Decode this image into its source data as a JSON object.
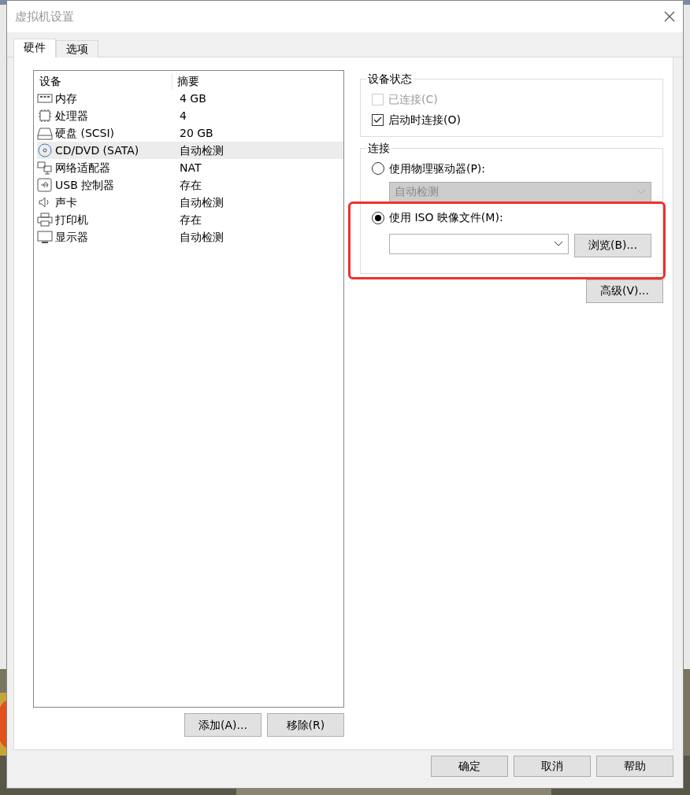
{
  "window": {
    "title": "虚拟机设置"
  },
  "tabs": [
    {
      "label": "硬件",
      "selected": true
    },
    {
      "label": "选项",
      "selected": false
    }
  ],
  "device_list": {
    "columns": [
      "设备",
      "摘要"
    ],
    "rows": [
      {
        "kind": "memory",
        "name": "内存",
        "summary": "4 GB",
        "selected": false
      },
      {
        "kind": "cpu",
        "name": "处理器",
        "summary": "4",
        "selected": false
      },
      {
        "kind": "disk",
        "name": "硬盘 (SCSI)",
        "summary": "20 GB",
        "selected": false
      },
      {
        "kind": "cdrom",
        "name": "CD/DVD (SATA)",
        "summary": "自动检测",
        "selected": true
      },
      {
        "kind": "network",
        "name": "网络适配器",
        "summary": "NAT",
        "selected": false
      },
      {
        "kind": "usb",
        "name": "USB 控制器",
        "summary": "存在",
        "selected": false
      },
      {
        "kind": "sound",
        "name": "声卡",
        "summary": "自动检测",
        "selected": false
      },
      {
        "kind": "printer",
        "name": "打印机",
        "summary": "存在",
        "selected": false
      },
      {
        "kind": "display",
        "name": "显示器",
        "summary": "自动检测",
        "selected": false
      }
    ]
  },
  "list_buttons": [
    "添加(A)...",
    "移除(R)"
  ],
  "device_status": {
    "title": "设备状态",
    "checkboxes": [
      {
        "label": "已连接(C)",
        "checked": false,
        "disabled": true
      },
      {
        "label": "启动时连接(O)",
        "checked": true,
        "disabled": false
      }
    ]
  },
  "connection": {
    "title": "连接",
    "physical": {
      "label": "使用物理驱动器(P):",
      "selected": false,
      "drive": {
        "value": "自动检测",
        "disabled": true
      }
    },
    "iso": {
      "label": "使用 ISO 映像文件(M):",
      "selected": true,
      "browse": "浏览(B)...",
      "highlighted": true
    }
  },
  "advanced_button": "高级(V)...",
  "footer_buttons": [
    "确定",
    "取消",
    "帮助"
  ]
}
